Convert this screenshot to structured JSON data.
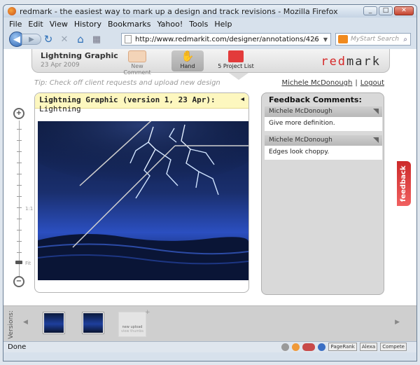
{
  "window": {
    "title": "redmark - the easiest way to mark up a design and track revisions - Mozilla Firefox",
    "min": "_",
    "max": "□",
    "close": "✕"
  },
  "menu": [
    "File",
    "Edit",
    "View",
    "History",
    "Bookmarks",
    "Yahoo!",
    "Tools",
    "Help"
  ],
  "nav": {
    "back": "◀",
    "forward": "▶",
    "reload": "↻",
    "stop": "✕",
    "home": "⌂",
    "url": "http://www.redmarkit.com/designer/annotations/426",
    "search_placeholder": "MyStart Search"
  },
  "app": {
    "project_title": "Lightning Graphic",
    "project_date": "23 Apr 2009",
    "tools": {
      "new_comment": "New Comment",
      "hand": "Hand",
      "hand_icon": "✋",
      "project_list_count": "5",
      "project_list": "Project List"
    },
    "logo_red": "red",
    "logo_dark": "mark",
    "tip": "Tip: Check off client requests and upload new design",
    "user": "Michele McDonough",
    "logout": "Logout",
    "zoom": {
      "plus": "+",
      "minus": "−",
      "label_1to1": "1:1",
      "label_fit": "Fit",
      "level": "Fit"
    },
    "design": {
      "heading": "Lightning Graphic (version 1, 23 Apr):",
      "version_name": "Lightning",
      "collapse_icon": "◀"
    },
    "feedback": {
      "heading": "Feedback Comments:",
      "comments": [
        {
          "author": "Michele McDonough",
          "text": "Give more definition."
        },
        {
          "author": "Michele McDonough",
          "text": "Edges look choppy."
        }
      ],
      "tab_label": "feedback"
    },
    "versions": {
      "label": "Versions:",
      "prev": "◀",
      "next": "▶",
      "new_upload": "new upload",
      "new_upload_sub": "view thumbs",
      "add": "+"
    }
  },
  "status": {
    "text": "Done",
    "pagerank": "PageRank",
    "alexa": "Alexa",
    "compete": "Compete"
  },
  "colors": {
    "brand_red": "#d62828",
    "note_yellow": "#fdf7bf",
    "panel_gray": "#d9d9d9"
  }
}
